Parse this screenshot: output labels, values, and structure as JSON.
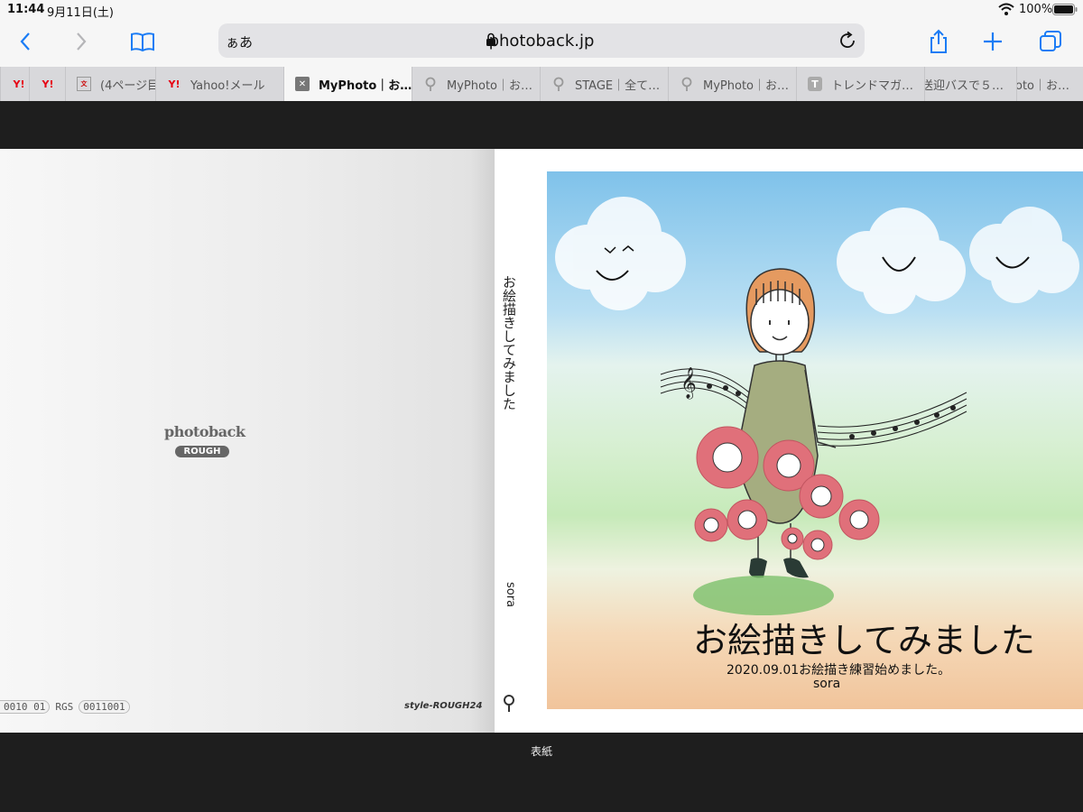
{
  "status": {
    "time": "11:44",
    "date": "9月11日(土)",
    "battery": "100%"
  },
  "toolbar": {
    "text_size_label": "ぁあ",
    "url": "photoback.jp"
  },
  "tabs": [
    {
      "label": "",
      "icon": "yahoo-icon"
    },
    {
      "label": "",
      "icon": "yahoo-icon"
    },
    {
      "label": "(4ページ目",
      "icon": "bunshun-icon"
    },
    {
      "label": "Yahoo!メール",
      "icon": "yahoo-icon"
    },
    {
      "label": "MyPhoto｜お…",
      "icon": "close-icon",
      "active": true
    },
    {
      "label": "MyPhoto｜お…",
      "icon": "photoback-icon"
    },
    {
      "label": "STAGE｜全て…",
      "icon": "photoback-icon"
    },
    {
      "label": "MyPhoto｜お…",
      "icon": "photoback-icon"
    },
    {
      "label": "トレンドマガ…",
      "icon": "t-icon"
    },
    {
      "label": "送迎バスで５…",
      "icon": ""
    },
    {
      "label": "oto｜お…",
      "icon": ""
    }
  ],
  "back_cover": {
    "logo_word": "photoback",
    "logo_badge": "ROUGH",
    "code_left": "0010 01",
    "code_mid": "RGS",
    "code_right": "0011001",
    "style": "style-ROUGH24"
  },
  "spine": {
    "title": "お絵描きしてみました",
    "author": "sora"
  },
  "front_cover": {
    "title": "お絵描きしてみました",
    "subtitle": "2020.09.01お絵描き練習始めました。",
    "author": "sora"
  },
  "page_label": "表紙",
  "colors": {
    "accent": "#1a7cf5",
    "flower": "#e0707a",
    "hair": "#e59a60",
    "dress": "#a5ad80"
  }
}
